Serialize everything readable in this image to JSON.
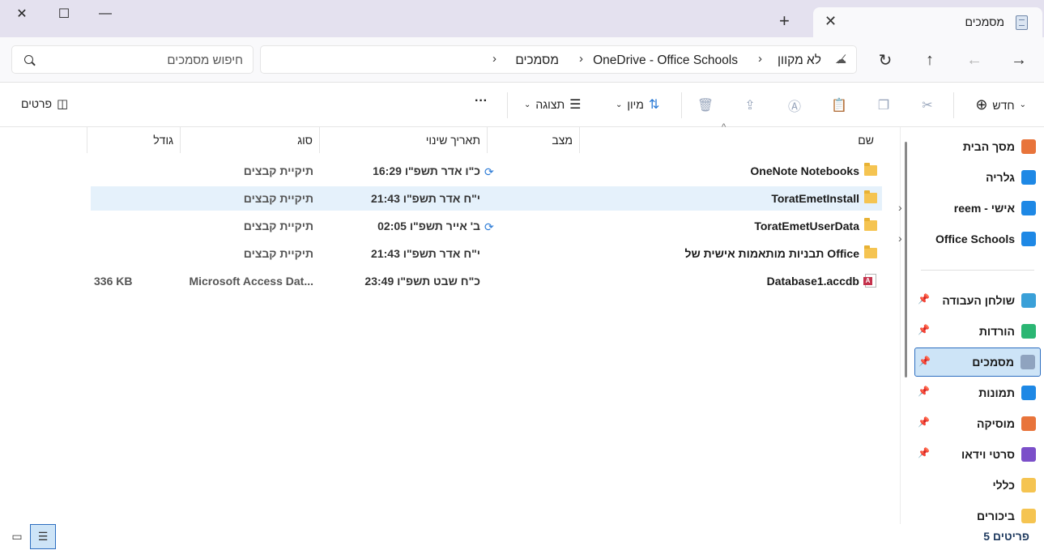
{
  "window": {
    "tab_title": "מסמכים",
    "tab_close": "✕",
    "tab_add": "+"
  },
  "nav": {
    "breadcrumbs": [
      "לא מקוון",
      "OneDrive - Office Schools",
      "מסמכים"
    ],
    "search_placeholder": "חיפוש מסמכים"
  },
  "toolbar": {
    "new_label": "חדש",
    "sort_label": "מיון",
    "view_label": "תצוגה",
    "more_label": "···",
    "details_label": "פרטים"
  },
  "columns": {
    "name": "שם",
    "status": "מצב",
    "modified": "תאריך שינוי",
    "type": "סוג",
    "size": "גודל"
  },
  "files": [
    {
      "name": "OneNote Notebooks",
      "icon": "folder-icon",
      "sync": true,
      "modified": "16:29 כ\"ו אדר תשפ\"ו",
      "type": "תיקיית קבצים",
      "size": "",
      "selected": false
    },
    {
      "name": "ToratEmetInstall",
      "icon": "folder-icon",
      "sync": false,
      "modified": "21:43 י\"ח אדר תשפ\"ו",
      "type": "תיקיית קבצים",
      "size": "",
      "selected": true
    },
    {
      "name": "ToratEmetUserData",
      "icon": "folder-icon",
      "sync": true,
      "modified": "02:05 ב' אייר תשפ\"ו",
      "type": "תיקיית קבצים",
      "size": "",
      "selected": false
    },
    {
      "name": "תבניות מותאמות אישית של Office",
      "icon": "folder-icon",
      "sync": false,
      "modified": "21:43 י\"ח אדר תשפ\"ו",
      "type": "תיקיית קבצים",
      "size": "",
      "selected": false
    },
    {
      "name": "Database1.accdb",
      "icon": "access-file-icon",
      "sync": false,
      "modified": "23:49 כ\"ח שבט תשפ\"ו",
      "type": "Microsoft Access Dat...",
      "size": "336 KB",
      "selected": false
    }
  ],
  "sidebar": {
    "items": [
      {
        "label": "מסך הבית",
        "icon": "home-icon",
        "color": "#e8743b",
        "pin": false,
        "chevron": false,
        "selected": false
      },
      {
        "label": "גלריה",
        "icon": "gallery-icon",
        "color": "#1e88e5",
        "pin": false,
        "chevron": false,
        "selected": false
      },
      {
        "label": "reem - אישי",
        "icon": "onedrive-cloud-icon",
        "color": "#1e88e5",
        "pin": false,
        "chevron": true,
        "selected": false
      },
      {
        "label": "Office Schools",
        "icon": "onedrive-cloud-icon",
        "color": "#1e88e5",
        "pin": false,
        "chevron": true,
        "selected": false
      },
      {
        "label": "שולחן העבודה",
        "icon": "desktop-icon",
        "color": "#3aa0d8",
        "pin": true,
        "chevron": false,
        "selected": false
      },
      {
        "label": "הורדות",
        "icon": "download-icon",
        "color": "#2bb673",
        "pin": true,
        "chevron": false,
        "selected": false
      },
      {
        "label": "מסמכים",
        "icon": "documents-icon",
        "color": "#8fa3bf",
        "pin": true,
        "chevron": false,
        "selected": true
      },
      {
        "label": "תמונות",
        "icon": "pictures-icon",
        "color": "#1e88e5",
        "pin": true,
        "chevron": false,
        "selected": false
      },
      {
        "label": "מוסיקה",
        "icon": "music-icon",
        "color": "#e8743b",
        "pin": true,
        "chevron": false,
        "selected": false
      },
      {
        "label": "סרטי וידאו",
        "icon": "video-icon",
        "color": "#7b4fc9",
        "pin": true,
        "chevron": false,
        "selected": false
      },
      {
        "label": "כללי",
        "icon": "folder-icon",
        "color": "#f5c451",
        "pin": false,
        "chevron": false,
        "selected": false
      },
      {
        "label": "ביכורים",
        "icon": "folder-icon",
        "color": "#f5c451",
        "pin": false,
        "chevron": false,
        "selected": false
      }
    ]
  },
  "status": {
    "item_count": "5 פריטים"
  }
}
